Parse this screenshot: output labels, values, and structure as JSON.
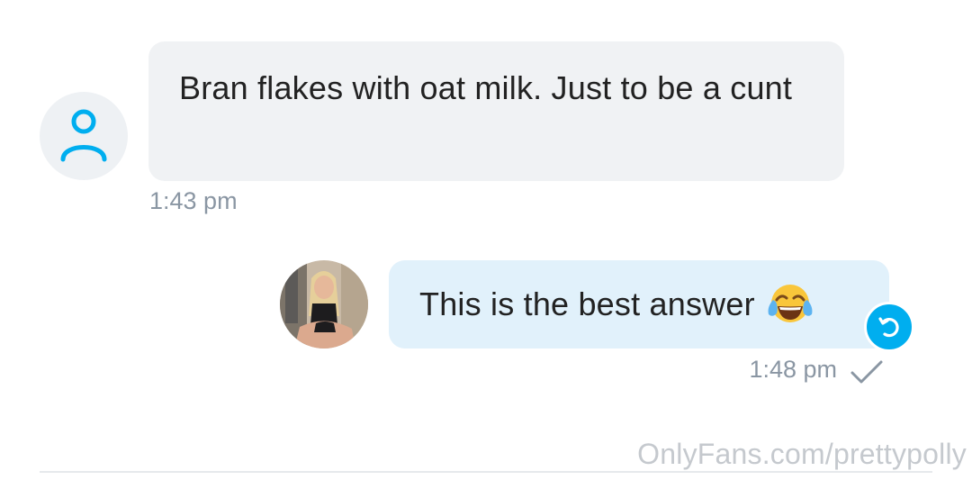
{
  "incoming": {
    "avatar_icon": "user-outline-icon",
    "text": "Bran flakes with oat milk. Just to be a cunt",
    "time": "1:43 pm"
  },
  "outgoing": {
    "avatar_icon": "profile-photo",
    "text": "This is the best answer",
    "emoji": "face-with-tears-of-joy-emoji",
    "action_icon": "undo-icon",
    "time": "1:48 pm",
    "status_icon": "checkmark-icon"
  },
  "watermark": "OnlyFans.com/prettypolly",
  "colors": {
    "accent": "#00aeef",
    "incoming_bubble": "#f0f2f4",
    "outgoing_bubble": "#e1f1fb",
    "timestamp": "#8a96a3"
  }
}
